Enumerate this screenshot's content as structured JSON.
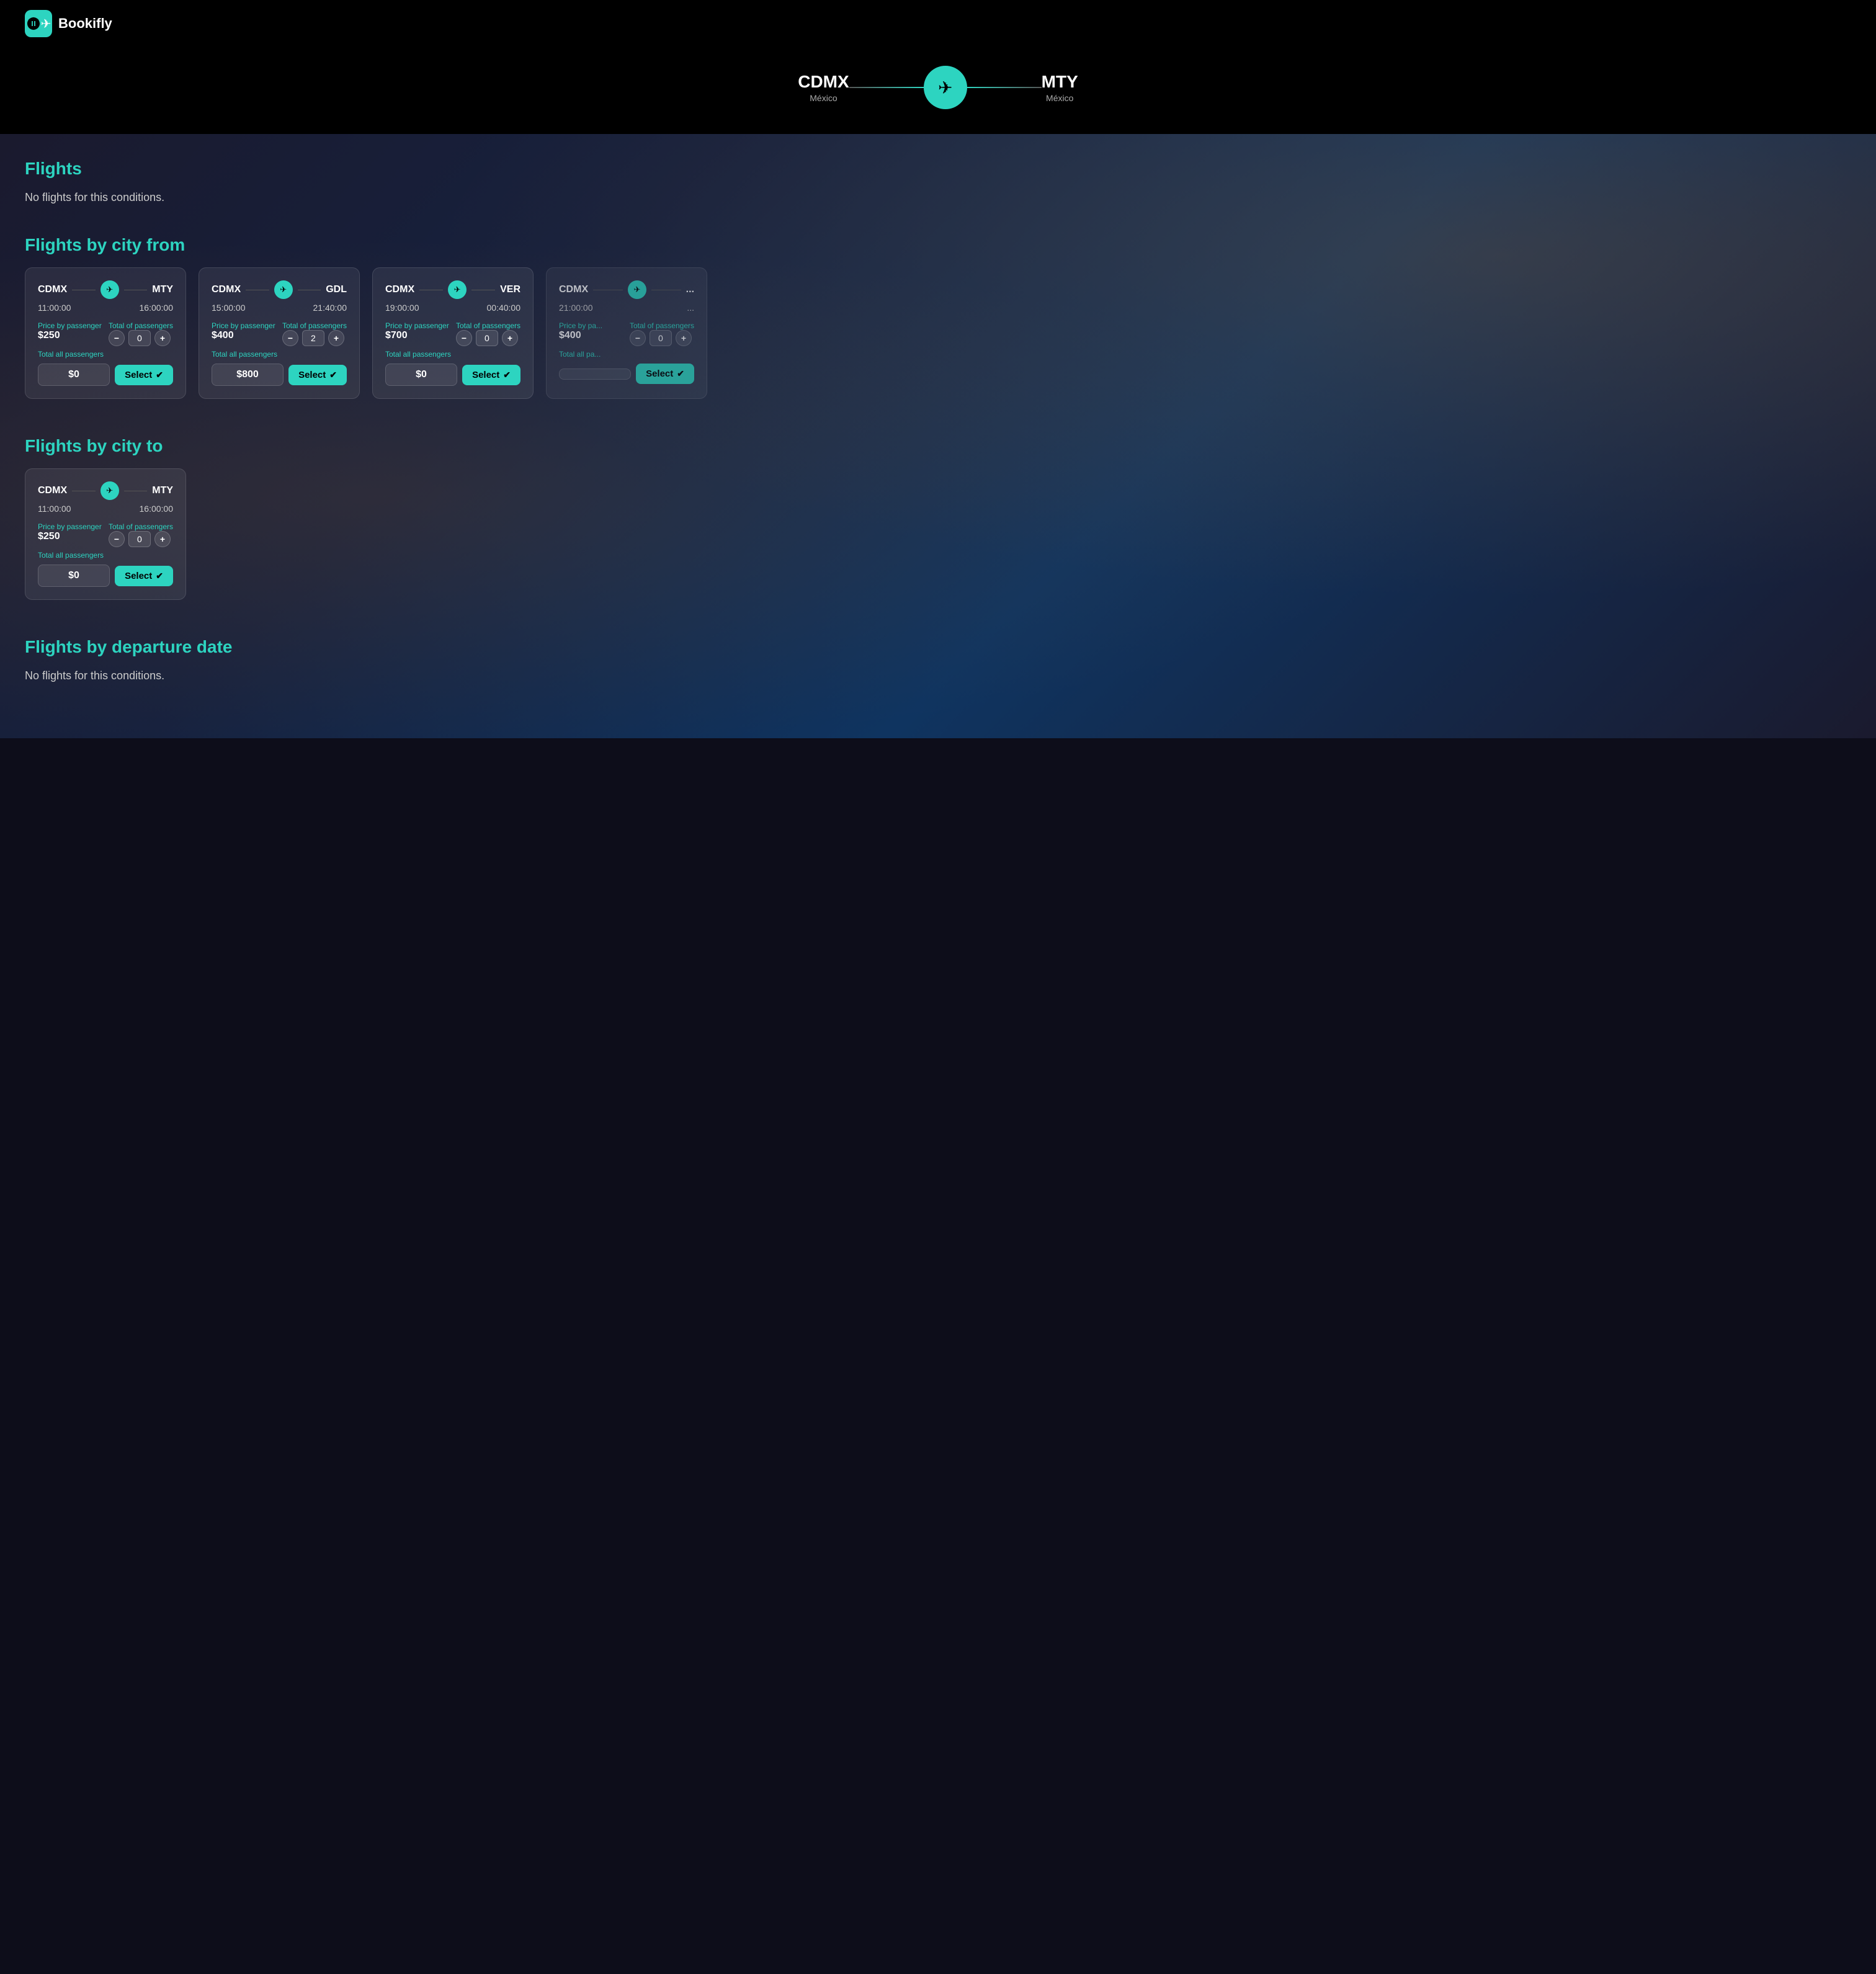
{
  "header": {
    "logo_icon": "✈",
    "logo_text": "Bookifly"
  },
  "route": {
    "from_code": "CDMX",
    "from_country": "México",
    "to_code": "MTY",
    "to_country": "México",
    "plane_icon": "✈"
  },
  "sections": {
    "flights": {
      "title": "Flights",
      "no_flights_text": "No flights for this conditions."
    },
    "flights_by_city_from": {
      "title": "Flights by city from",
      "cards": [
        {
          "from": "CDMX",
          "to": "MTY",
          "depart_time": "11:00:00",
          "arrive_time": "16:00:00",
          "price_label": "Price by passenger",
          "price": "$250",
          "passengers_label": "Total of passengers",
          "passengers_count": "0",
          "total_label": "Total all passengers",
          "total_amount": "$0",
          "select_label": "Select"
        },
        {
          "from": "CDMX",
          "to": "GDL",
          "depart_time": "15:00:00",
          "arrive_time": "21:40:00",
          "price_label": "Price by passenger",
          "price": "$400",
          "passengers_label": "Total of passengers",
          "passengers_count": "2",
          "total_label": "Total all passengers",
          "total_amount": "$800",
          "select_label": "Select"
        },
        {
          "from": "CDMX",
          "to": "VER",
          "depart_time": "19:00:00",
          "arrive_time": "00:40:00",
          "price_label": "Price by passenger",
          "price": "$700",
          "passengers_label": "Total of passengers",
          "passengers_count": "0",
          "total_label": "Total all passengers",
          "total_amount": "$0",
          "select_label": "Select"
        },
        {
          "from": "CDMX",
          "to": "...",
          "depart_time": "21:00:00",
          "arrive_time": "...",
          "price_label": "Price by pa...",
          "price": "$400",
          "passengers_label": "Total of passengers",
          "passengers_count": "0",
          "total_label": "Total all pa...",
          "total_amount": "",
          "select_label": "Select"
        }
      ]
    },
    "flights_by_city_to": {
      "title": "Flights by city to",
      "cards": [
        {
          "from": "CDMX",
          "to": "MTY",
          "depart_time": "11:00:00",
          "arrive_time": "16:00:00",
          "price_label": "Price by passenger",
          "price": "$250",
          "passengers_label": "Total of passengers",
          "passengers_count": "0",
          "total_label": "Total all passengers",
          "total_amount": "$0",
          "select_label": "Select"
        }
      ]
    },
    "flights_by_departure": {
      "title": "Flights by departure date",
      "no_flights_text": "No flights for this conditions."
    }
  },
  "icons": {
    "plane": "✈",
    "checkmark": "✔",
    "minus": "−",
    "plus": "+"
  }
}
